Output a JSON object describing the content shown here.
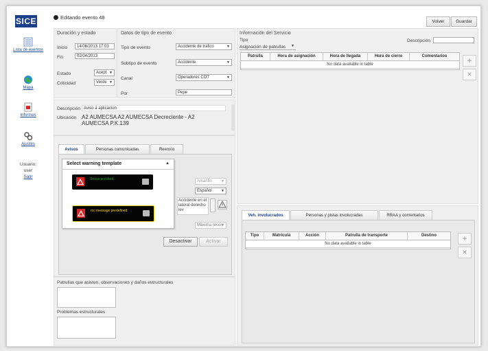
{
  "sidebar": {
    "logo": "SICE",
    "items": [
      {
        "label": "Lista de eventos",
        "icon": "list-icon"
      },
      {
        "label": "Mapa",
        "icon": "globe-icon"
      },
      {
        "label": "Informes",
        "icon": "report-icon"
      },
      {
        "label": "Ajustes",
        "icon": "settings-icon"
      }
    ],
    "user_label": "Usuario:",
    "user_name": "user",
    "logout": "Salir"
  },
  "header": {
    "title": "Editando evento 48",
    "back_button": "Volver",
    "save_button": "Guardar"
  },
  "duration": {
    "title": "Duración y estado",
    "start_label": "Inicio",
    "start_value": "14/06/2013 17:03",
    "end_label": "Fin",
    "end_value": "02/04/2013",
    "state_label": "Estado",
    "state_value": "Acept",
    "criticality_label": "Criticidad",
    "criticality_value": "Verde"
  },
  "event_type": {
    "title": "Datos de tipo de evento",
    "type_label": "Tipo de evento",
    "type_value": "Accidente de trafico",
    "subtype_label": "Subtipo de evento",
    "subtype_value": "Accidente",
    "channel_label": "Canal",
    "channel_value": "Operadores COT",
    "by_label": "Por",
    "by_value": "Pepe"
  },
  "description": {
    "label": "Descripción",
    "value": "Aviso a aplicacion",
    "location_label": "Ubicación",
    "location_value": "A2 AUMECSA A2 AUMECSA Decreciente - A2 AUMECSA P.K.139"
  },
  "notify": {
    "tabs": [
      "Avisos",
      "Personas comunicadas",
      "Reenvío"
    ],
    "active_tab": 0,
    "template_select": "Select warning template",
    "templates": [
      {
        "text": "Serius accident.",
        "color": "#1fae2a"
      },
      {
        "text": "rcc message predefined",
        "color": "#f2d21d"
      }
    ],
    "level_value": "Amarillo",
    "language_value": "Español",
    "message_value": "Accidente en el lateral derecho lev",
    "speed_value": "Máxima recor",
    "deactivate_button": "Desactivar",
    "activate_button": "Activar"
  },
  "bottom_left": {
    "patrols_label": "Patrullas que asisten, observaciones y daños estructurales",
    "problems_label": "Problemas estructurales"
  },
  "service": {
    "title": "Información del Servicio",
    "type_label": "Tipo",
    "description_label": "Descripción",
    "patrols_title": "Asignación de patrullas",
    "columns": [
      "Patrulla",
      "Hora de asignación",
      "Hora de llegada",
      "Hora de cierre",
      "Comentarios"
    ],
    "no_data": "No data available in table"
  },
  "vehicles": {
    "tabs": [
      "Veh. involucrados",
      "Personas y pistas involucradas",
      "RRAA y comentarios"
    ],
    "active_tab": 0,
    "columns": [
      "Tipo",
      "Matrícula",
      "Acción",
      "Patrulla de transporte",
      "Destino"
    ],
    "no_data": "No data available in table"
  },
  "colors": {
    "brand": "#1c3f8a",
    "link": "#1a4a9a"
  }
}
